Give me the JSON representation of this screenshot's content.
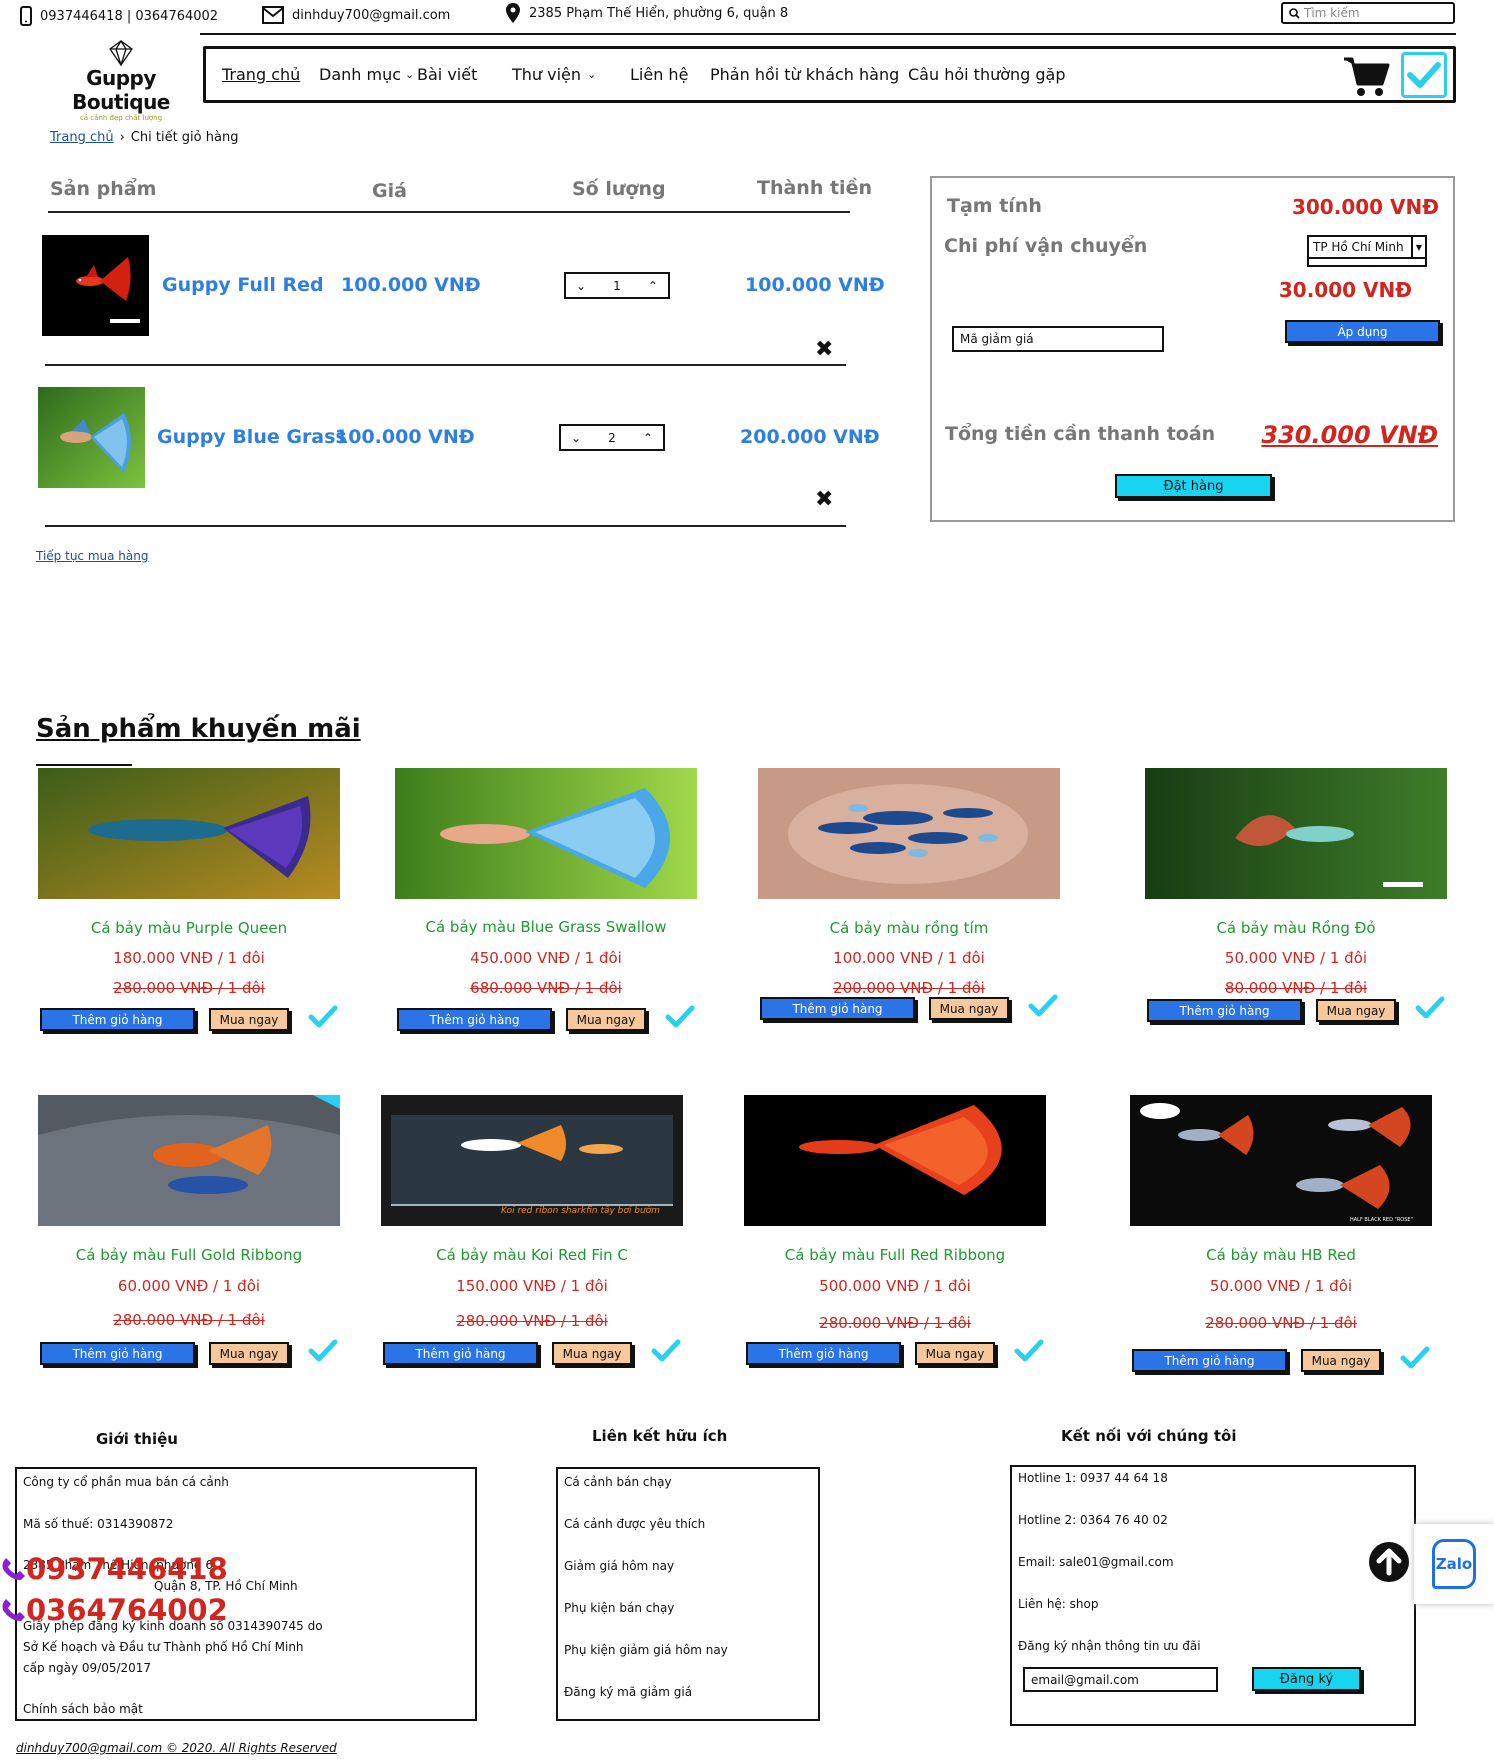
{
  "topbar": {
    "phones": "0937446418 | 0364764002",
    "email": "dinhduy700@gmail.com",
    "address": "2385 Phạm Thế Hiển, phường 6, quận 8",
    "search_placeholder": "Tìm kiếm"
  },
  "logo": {
    "name": "Guppy Boutique",
    "tagline": "cá cảnh đẹp chất lượng"
  },
  "nav": [
    "Trang chủ",
    "Danh mục",
    "Bài viết",
    "Thư viện",
    "Liên hệ",
    "Phản hồi từ khách hàng",
    "Câu hỏi thường gặp"
  ],
  "breadcrumb": {
    "home": "Trang chủ",
    "current": "Chi tiết giỏ hàng"
  },
  "cart": {
    "headers": {
      "product": "Sản phẩm",
      "price": "Giá",
      "qty": "Số lượng",
      "total": "Thành tiền"
    },
    "items": [
      {
        "name": "Guppy Full Red",
        "price": "100.000 VNĐ",
        "qty": "1",
        "total": "100.000 VNĐ"
      },
      {
        "name": "Guppy Blue Grass",
        "price": "100.000 VNĐ",
        "qty": "2",
        "total": "200.000 VNĐ"
      }
    ],
    "continue": "Tiếp tục mua hàng"
  },
  "summary": {
    "subtotal_label": "Tạm tính",
    "subtotal": "300.000 VNĐ",
    "shipping_label": "Chi phí vận chuyển",
    "city": "TP Hồ Chí Minh",
    "shipping": "30.000 VNĐ",
    "coupon_placeholder": "Mã giảm giá",
    "apply": "Áp dụng",
    "grand_label": "Tổng tiền cần thanh toán",
    "grand": "330.000 VNĐ",
    "order": "Đặt hàng"
  },
  "promo": {
    "title": "Sản phẩm khuyến mãi",
    "add_label": "Thêm giỏ hàng",
    "buy_label": "Mua ngay",
    "products": [
      {
        "name": "Cá bảy màu Purple Queen",
        "price": "180.000 VNĐ / 1 đôi",
        "old": "280.000 VNĐ / 1 đôi"
      },
      {
        "name": "Cá bảy màu Blue Grass Swallow",
        "price": "450.000 VNĐ / 1 đôi",
        "old": "680.000 VNĐ / 1 đôi"
      },
      {
        "name": "Cá bảy màu rồng tím",
        "price": "100.000 VNĐ / 1 đôi",
        "old": "200.000 VNĐ / 1 đôi"
      },
      {
        "name": "Cá bảy màu Rồng Đỏ",
        "price": "50.000 VNĐ / 1 đôi",
        "old": "80.000 VNĐ / 1 đôi"
      },
      {
        "name": "Cá bảy màu Full Gold Ribbong",
        "price": "60.000 VNĐ / 1 đôi",
        "old": "280.000 VNĐ / 1 đôi"
      },
      {
        "name": "Cá bảy màu Koi Red Fin C",
        "price": "150.000 VNĐ / 1 đôi",
        "old": "280.000 VNĐ / 1 đôi"
      },
      {
        "name": "Cá bảy màu Full Red Ribbong",
        "price": "500.000 VNĐ / 1 đôi",
        "old": "280.000 VNĐ / 1 đôi"
      },
      {
        "name": "Cá bảy màu HB Red",
        "price": "50.000 VNĐ / 1 đôi",
        "old": "280.000 VNĐ / 1 đôi"
      }
    ],
    "image_captions": {
      "koi": "Koi red ribon sharkfin tây bơi bướm",
      "hb": "HALF BLACK RED \"ROSE\""
    }
  },
  "footer": {
    "intro_title": "Giới thiệu",
    "intro": [
      "Công ty cổ phần mua bán cá cảnh",
      "Mã số thuế: 0314390872",
      "2385 Phạm Thế Hiển, phường 6,",
      "Quận 8, TP. Hồ Chí Minh",
      "Giấy phép đăng ký kinh doanh số 0314390745 do",
      "Sở Kế hoạch và Đầu tư Thành phố Hồ Chí Minh",
      "cấp ngày 09/05/2017",
      "Chính sách bảo mật"
    ],
    "links_title": "Liên kết hữu ích",
    "links": [
      "Cá cảnh bán chạy",
      "Cá cảnh được yêu thích",
      "Giảm giá hôm nay",
      "Phụ kiện bán chạy",
      "Phụ kiện giảm giá hôm nay",
      "Đăng ký mã giảm giá"
    ],
    "connect_title": "Kết nối với chúng tôi",
    "connect": [
      "Hotline 1: 0937 44 64 18",
      "Hotline 2: 0364 76 40 02",
      "Email: sale01@gmail.com",
      "Liên hệ: shop",
      "Đăng ký nhận thông tin ưu đãi"
    ],
    "newsletter_value": "email@gmail.com",
    "register": "Đăng ký",
    "call1": "0937446418",
    "call2": "0364764002",
    "zalo": "Zalo",
    "copyright": "dinhduy700@gmail.com © 2020. All Rights Reserved"
  },
  "colors": {
    "accent_blue": "#2b74e8",
    "price_red": "#d0261f",
    "title_green": "#1e9b2e",
    "cyan": "#17d4f0",
    "peach": "#f7c89b"
  }
}
